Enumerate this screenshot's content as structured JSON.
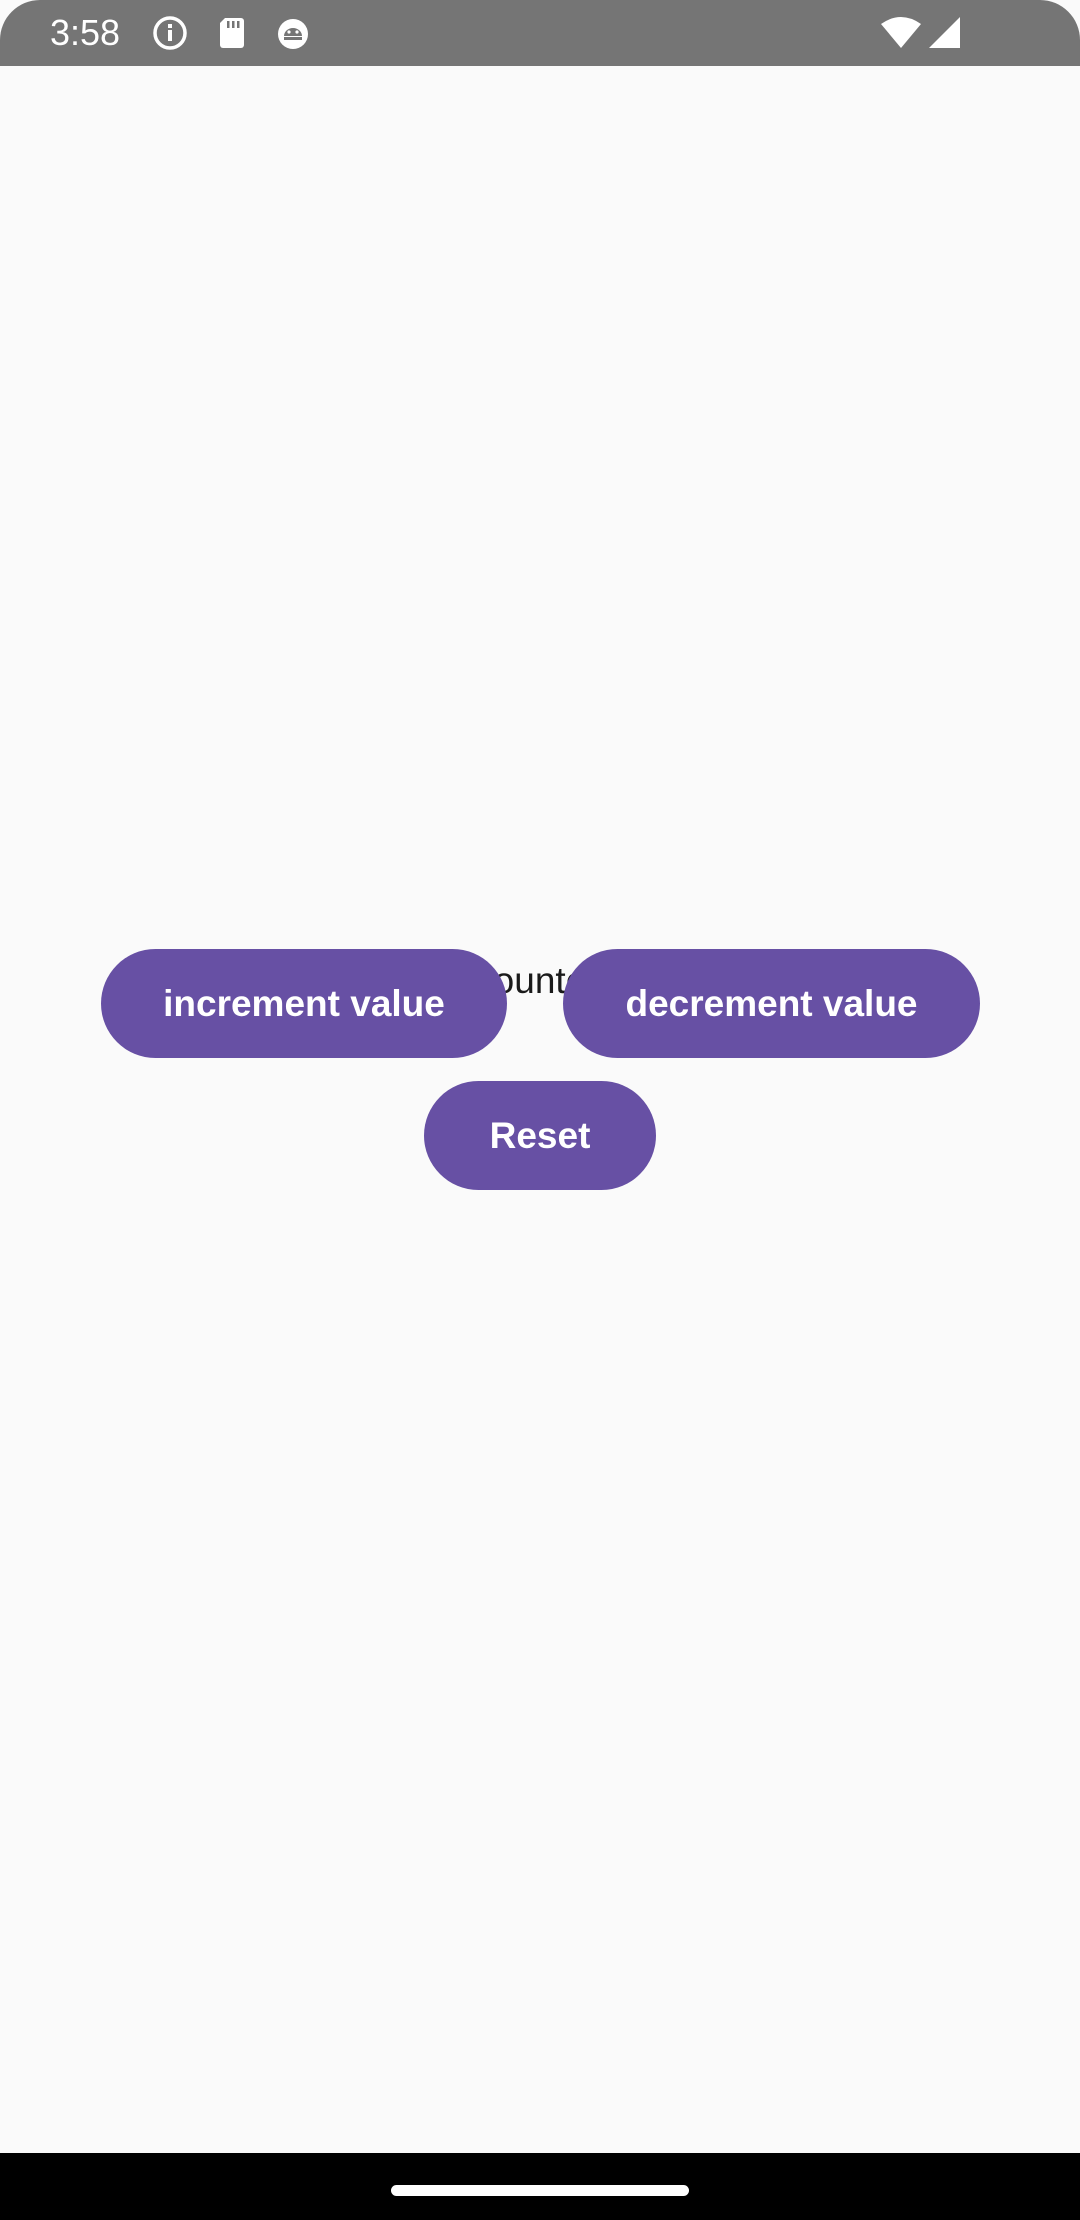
{
  "status_bar": {
    "time": "3:58",
    "icons": [
      "info-icon",
      "sd-card-icon",
      "android-debug-icon",
      "wifi-icon",
      "cellular-signal-icon"
    ],
    "background_color": "#757575"
  },
  "main": {
    "counter_text": "Current counter value: 6",
    "buttons": {
      "increment_label": "increment value",
      "decrement_label": "decrement value",
      "reset_label": "Reset"
    },
    "accent_color": "#6750a4",
    "background_color": "#fafafa"
  },
  "nav_bar": {
    "background_color": "#000000",
    "handle_icon": "home-handle-icon"
  }
}
